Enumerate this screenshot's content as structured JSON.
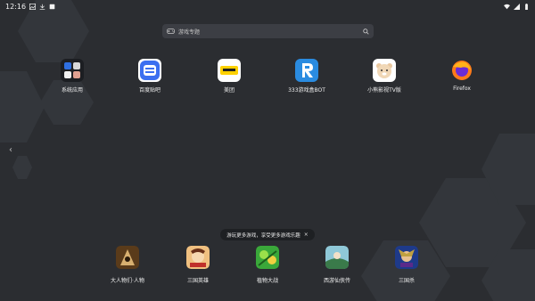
{
  "status_bar": {
    "time": "12:16",
    "left_icons": [
      "image-icon",
      "download-icon",
      "notification-icon"
    ],
    "right_icons": [
      "wifi-icon",
      "signal-icon",
      "battery-icon"
    ]
  },
  "search": {
    "placeholder": "游戏专题",
    "left_icon": "gamepad-icon",
    "right_icon": "search-icon"
  },
  "apps": [
    {
      "label": "系统应用",
      "icon": "system-apps-folder-icon"
    },
    {
      "label": "百度贴吧",
      "icon": "tieba-icon"
    },
    {
      "label": "美团",
      "icon": "meituan-icon"
    },
    {
      "label": "333游戏盒BOT",
      "icon": "r-logo-icon"
    },
    {
      "label": "小熊影视TV版",
      "icon": "bear-icon"
    },
    {
      "label": "Firefox",
      "icon": "firefox-icon"
    }
  ],
  "toast": {
    "text": "游玩更多游戏，享受更多游戏乐趣",
    "close": "×"
  },
  "dock": [
    {
      "label": "大人物们·人物",
      "icon": "game-1-icon"
    },
    {
      "label": "三国英雄",
      "icon": "game-2-icon"
    },
    {
      "label": "植物大战",
      "icon": "game-3-icon"
    },
    {
      "label": "西游仙侠传",
      "icon": "game-4-icon"
    },
    {
      "label": "三国杀",
      "icon": "game-5-icon"
    }
  ],
  "colors": {
    "background": "#2b2d31",
    "search_bg": "#3c3e44",
    "toast_bg": "#1e2023"
  }
}
